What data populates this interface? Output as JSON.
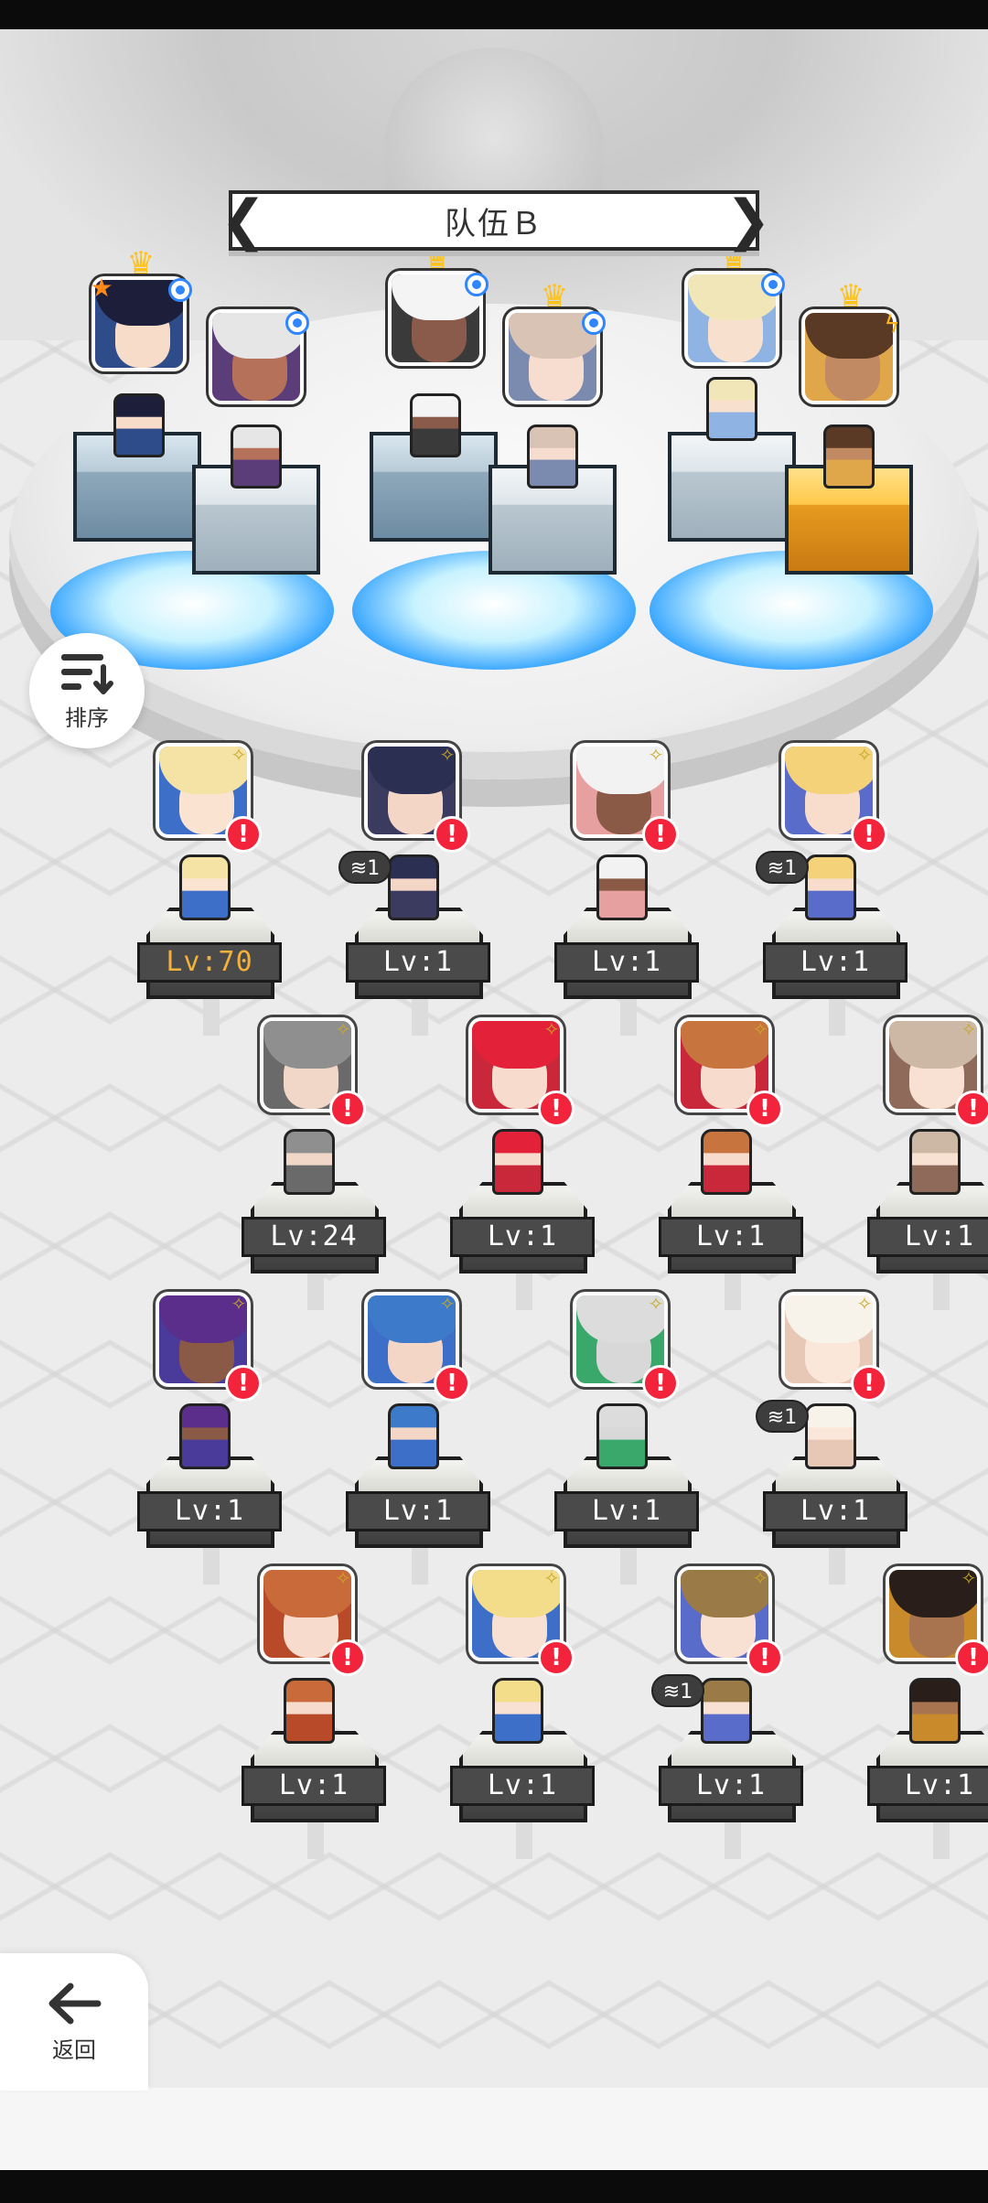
{
  "team": {
    "title": "队伍Ｂ",
    "prev": "❮",
    "next": "❯"
  },
  "controls": {
    "sort_label": "排序",
    "back_label": "返回"
  },
  "formation": [
    {
      "crown": "♛",
      "badge": "blue",
      "extra": "star",
      "hair": "#1d1f3a",
      "face": "#f6dcc9",
      "body": "#2f4c8a"
    },
    {
      "crown": "",
      "badge": "blue",
      "extra": "",
      "hair": "#e6e6e6",
      "face": "#b5715a",
      "body": "#5b3d7a"
    },
    {
      "crown": "♛",
      "badge": "blue",
      "extra": "",
      "hair": "#f4f4f4",
      "face": "#8a5a4a",
      "body": "#3a3a3a"
    },
    {
      "crown": "♛",
      "badge": "blue",
      "extra": "",
      "hair": "#d8c3b4",
      "face": "#f7ddd0",
      "body": "#7b8bb0"
    },
    {
      "crown": "♛",
      "badge": "blue",
      "extra": "",
      "hair": "#f1e6b8",
      "face": "#f8e0cf",
      "body": "#8fb4e3"
    },
    {
      "crown": "♛",
      "badge": "",
      "extra": "bolt",
      "hair": "#5a3a24",
      "face": "#c28a62",
      "body": "#e0a64a"
    }
  ],
  "roster": [
    {
      "level": "Lv:70",
      "gold": true,
      "copies": "",
      "hair": "#f5e3a6",
      "face": "#fbe3d2",
      "body": "#3d6fc9"
    },
    {
      "level": "Lv:1",
      "gold": false,
      "copies": "1",
      "hair": "#2b2f52",
      "face": "#f4d6c6",
      "body": "#3b3b60"
    },
    {
      "level": "Lv:1",
      "gold": false,
      "copies": "",
      "hair": "#f2f2f2",
      "face": "#8a5a46",
      "body": "#e6a0a0"
    },
    {
      "level": "Lv:1",
      "gold": false,
      "copies": "1",
      "hair": "#f3d27a",
      "face": "#f8ddcc",
      "body": "#5a6cc9"
    },
    {
      "level": "Lv:24",
      "gold": false,
      "copies": "",
      "hair": "#8f8f8f",
      "face": "#f1d7c8",
      "body": "#6a6a6a"
    },
    {
      "level": "Lv:1",
      "gold": false,
      "copies": "",
      "hair": "#e3223a",
      "face": "#f7dccd",
      "body": "#c8283a"
    },
    {
      "level": "Lv:1",
      "gold": false,
      "copies": "",
      "hair": "#c8743e",
      "face": "#f7dccd",
      "body": "#c8283a"
    },
    {
      "level": "Lv:1",
      "gold": false,
      "copies": "",
      "hair": "#cdb8a6",
      "face": "#f8e1d3",
      "body": "#8f6a5a"
    },
    {
      "level": "Lv:1",
      "gold": false,
      "copies": "",
      "hair": "#5a2e8a",
      "face": "#8a5a46",
      "body": "#4a3a9a"
    },
    {
      "level": "Lv:1",
      "gold": false,
      "copies": "",
      "hair": "#3d7ac9",
      "face": "#f4d6c6",
      "body": "#3d6fc9"
    },
    {
      "level": "Lv:1",
      "gold": false,
      "copies": "",
      "hair": "#dcdcdc",
      "face": "#d8d8d8",
      "body": "#3aa86a"
    },
    {
      "level": "Lv:1",
      "gold": false,
      "copies": "1",
      "hair": "#f7f3ea",
      "face": "#fbe6da",
      "body": "#e7c7b6"
    },
    {
      "level": "Lv:1",
      "gold": false,
      "copies": "",
      "hair": "#c86a3a",
      "face": "#f7dccd",
      "body": "#b84a2a"
    },
    {
      "level": "Lv:1",
      "gold": false,
      "copies": "",
      "hair": "#f3dc8a",
      "face": "#f8e1d3",
      "body": "#3d6fc9"
    },
    {
      "level": "Lv:1",
      "gold": false,
      "copies": "1",
      "hair": "#9a7a46",
      "face": "#f8e1d3",
      "body": "#5a6cc9"
    },
    {
      "level": "Lv:1",
      "gold": false,
      "copies": "",
      "hair": "#2a1e1a",
      "face": "#a8734f",
      "body": "#c88a2a"
    }
  ],
  "icons": {
    "sort": "sort-icon",
    "back": "arrow-left-icon",
    "alert": "!",
    "sparkle": "✧"
  },
  "colors": {
    "alert_red": "#f2233a",
    "level_gold": "#f3b13a",
    "crown_gold": "#ffc21a",
    "badge_blue": "#2f86ff"
  }
}
